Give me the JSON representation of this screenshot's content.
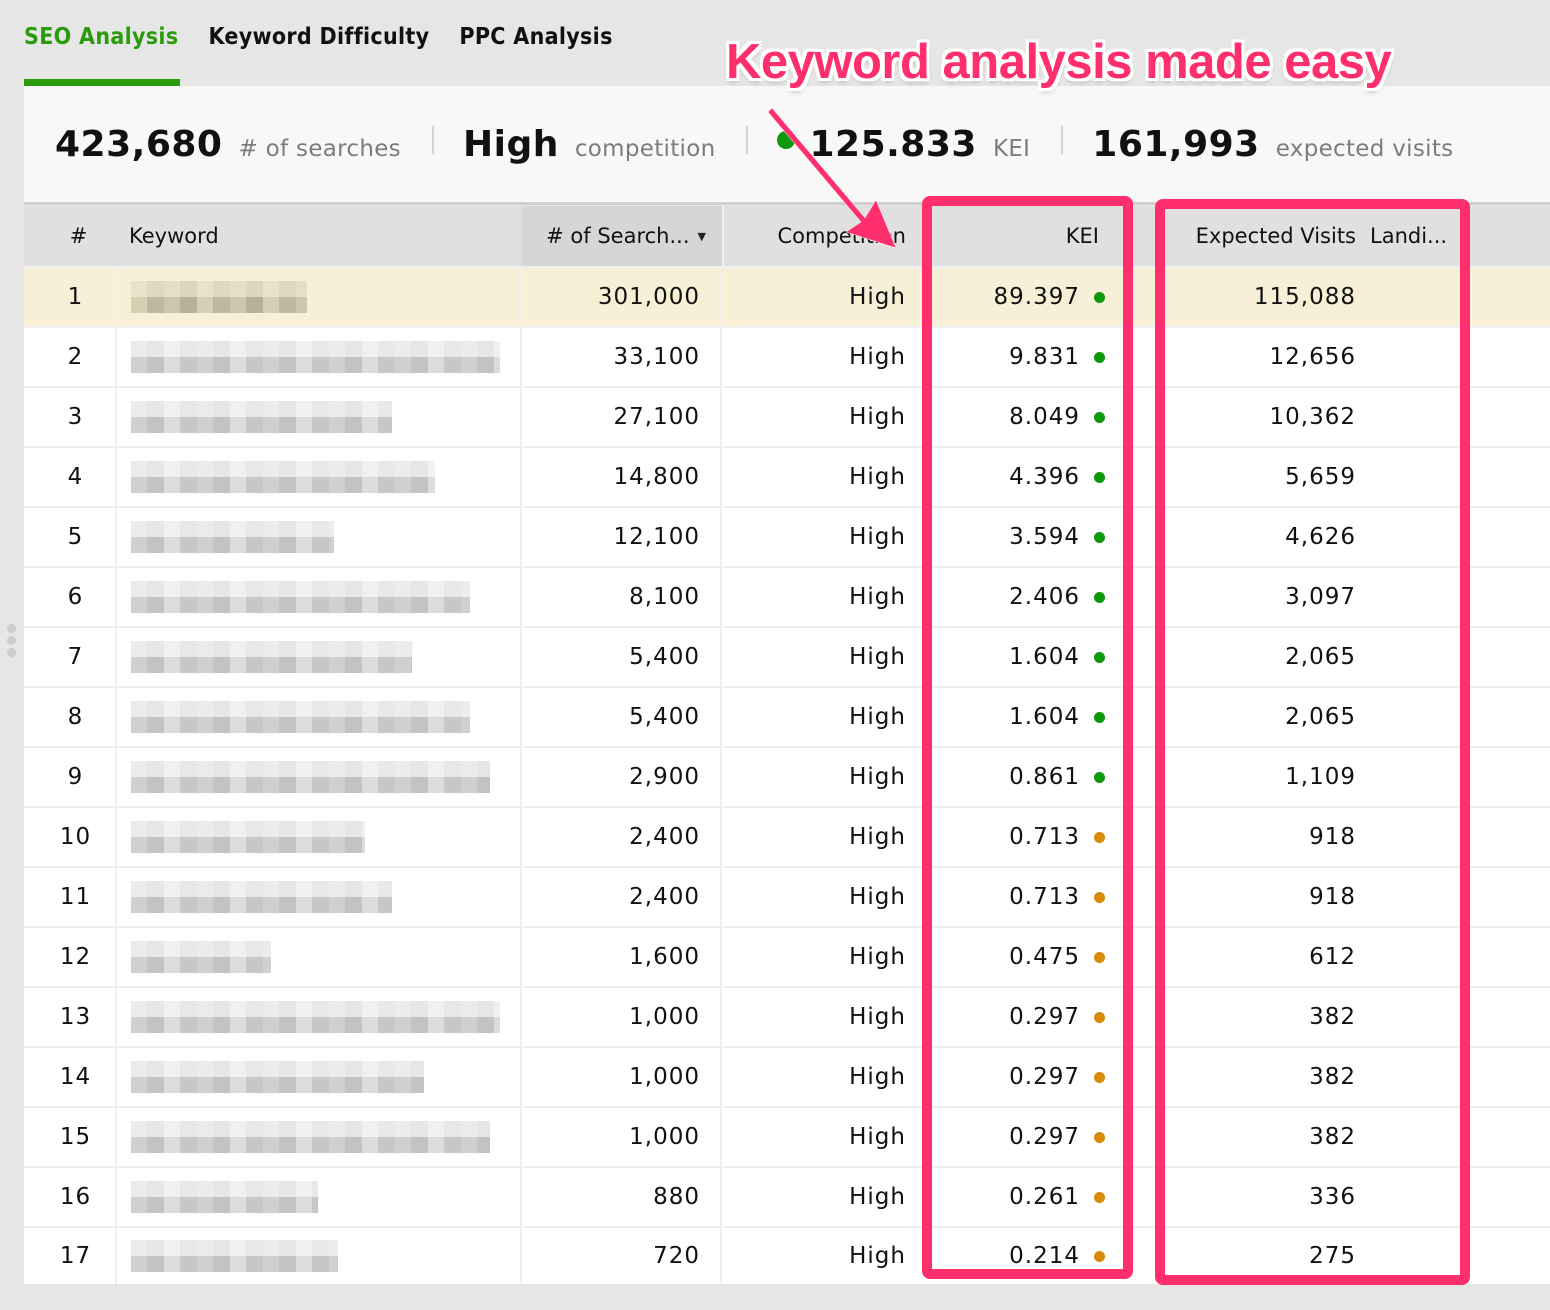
{
  "tabs": [
    {
      "label": "SEO Analysis",
      "active": true
    },
    {
      "label": "Keyword Difficulty",
      "active": false
    },
    {
      "label": "PPC Analysis",
      "active": false
    }
  ],
  "summary": {
    "searches": {
      "value": "423,680",
      "label": "# of searches"
    },
    "competition": {
      "value": "High",
      "label": "competition"
    },
    "kei": {
      "value": "125.833",
      "label": "KEI",
      "status_color": "#0c9a0c"
    },
    "expected_visits": {
      "value": "161,993",
      "label": "expected visits"
    }
  },
  "annotation": {
    "headline": "Keyword analysis made easy",
    "color": "#ff2f6e"
  },
  "table": {
    "columns": {
      "num": "#",
      "keyword": "Keyword",
      "searches": "# of Search...",
      "competition": "Competition",
      "kei": "KEI",
      "expected_visits": "Expected Visits",
      "landing": "Landi..."
    },
    "sorted_column": "searches",
    "status_colors": {
      "good": "#0c9a0c",
      "medium": "#d88a0a"
    },
    "rows": [
      {
        "num": "1",
        "keyword": "[redacted]",
        "searches": "301,000",
        "competition": "High",
        "kei": "89.397",
        "kei_status": "good",
        "expected_visits": "115,088",
        "selected": true
      },
      {
        "num": "2",
        "keyword": "[redacted]",
        "searches": "33,100",
        "competition": "High",
        "kei": "9.831",
        "kei_status": "good",
        "expected_visits": "12,656"
      },
      {
        "num": "3",
        "keyword": "[redacted]",
        "searches": "27,100",
        "competition": "High",
        "kei": "8.049",
        "kei_status": "good",
        "expected_visits": "10,362"
      },
      {
        "num": "4",
        "keyword": "[redacted]",
        "searches": "14,800",
        "competition": "High",
        "kei": "4.396",
        "kei_status": "good",
        "expected_visits": "5,659"
      },
      {
        "num": "5",
        "keyword": "[redacted]",
        "searches": "12,100",
        "competition": "High",
        "kei": "3.594",
        "kei_status": "good",
        "expected_visits": "4,626"
      },
      {
        "num": "6",
        "keyword": "[redacted]",
        "searches": "8,100",
        "competition": "High",
        "kei": "2.406",
        "kei_status": "good",
        "expected_visits": "3,097"
      },
      {
        "num": "7",
        "keyword": "[redacted]",
        "searches": "5,400",
        "competition": "High",
        "kei": "1.604",
        "kei_status": "good",
        "expected_visits": "2,065"
      },
      {
        "num": "8",
        "keyword": "[redacted]",
        "searches": "5,400",
        "competition": "High",
        "kei": "1.604",
        "kei_status": "good",
        "expected_visits": "2,065"
      },
      {
        "num": "9",
        "keyword": "[redacted]",
        "searches": "2,900",
        "competition": "High",
        "kei": "0.861",
        "kei_status": "good",
        "expected_visits": "1,109"
      },
      {
        "num": "10",
        "keyword": "[redacted]",
        "searches": "2,400",
        "competition": "High",
        "kei": "0.713",
        "kei_status": "medium",
        "expected_visits": "918"
      },
      {
        "num": "11",
        "keyword": "[redacted]",
        "searches": "2,400",
        "competition": "High",
        "kei": "0.713",
        "kei_status": "medium",
        "expected_visits": "918"
      },
      {
        "num": "12",
        "keyword": "[redacted]",
        "searches": "1,600",
        "competition": "High",
        "kei": "0.475",
        "kei_status": "medium",
        "expected_visits": "612"
      },
      {
        "num": "13",
        "keyword": "[redacted]",
        "searches": "1,000",
        "competition": "High",
        "kei": "0.297",
        "kei_status": "medium",
        "expected_visits": "382"
      },
      {
        "num": "14",
        "keyword": "[redacted]",
        "searches": "1,000",
        "competition": "High",
        "kei": "0.297",
        "kei_status": "medium",
        "expected_visits": "382"
      },
      {
        "num": "15",
        "keyword": "[redacted]",
        "searches": "1,000",
        "competition": "High",
        "kei": "0.297",
        "kei_status": "medium",
        "expected_visits": "382"
      },
      {
        "num": "16",
        "keyword": "[redacted]",
        "searches": "880",
        "competition": "High",
        "kei": "0.261",
        "kei_status": "medium",
        "expected_visits": "336"
      },
      {
        "num": "17",
        "keyword": "[redacted]",
        "searches": "720",
        "competition": "High",
        "kei": "0.214",
        "kei_status": "medium",
        "expected_visits": "275"
      }
    ]
  }
}
